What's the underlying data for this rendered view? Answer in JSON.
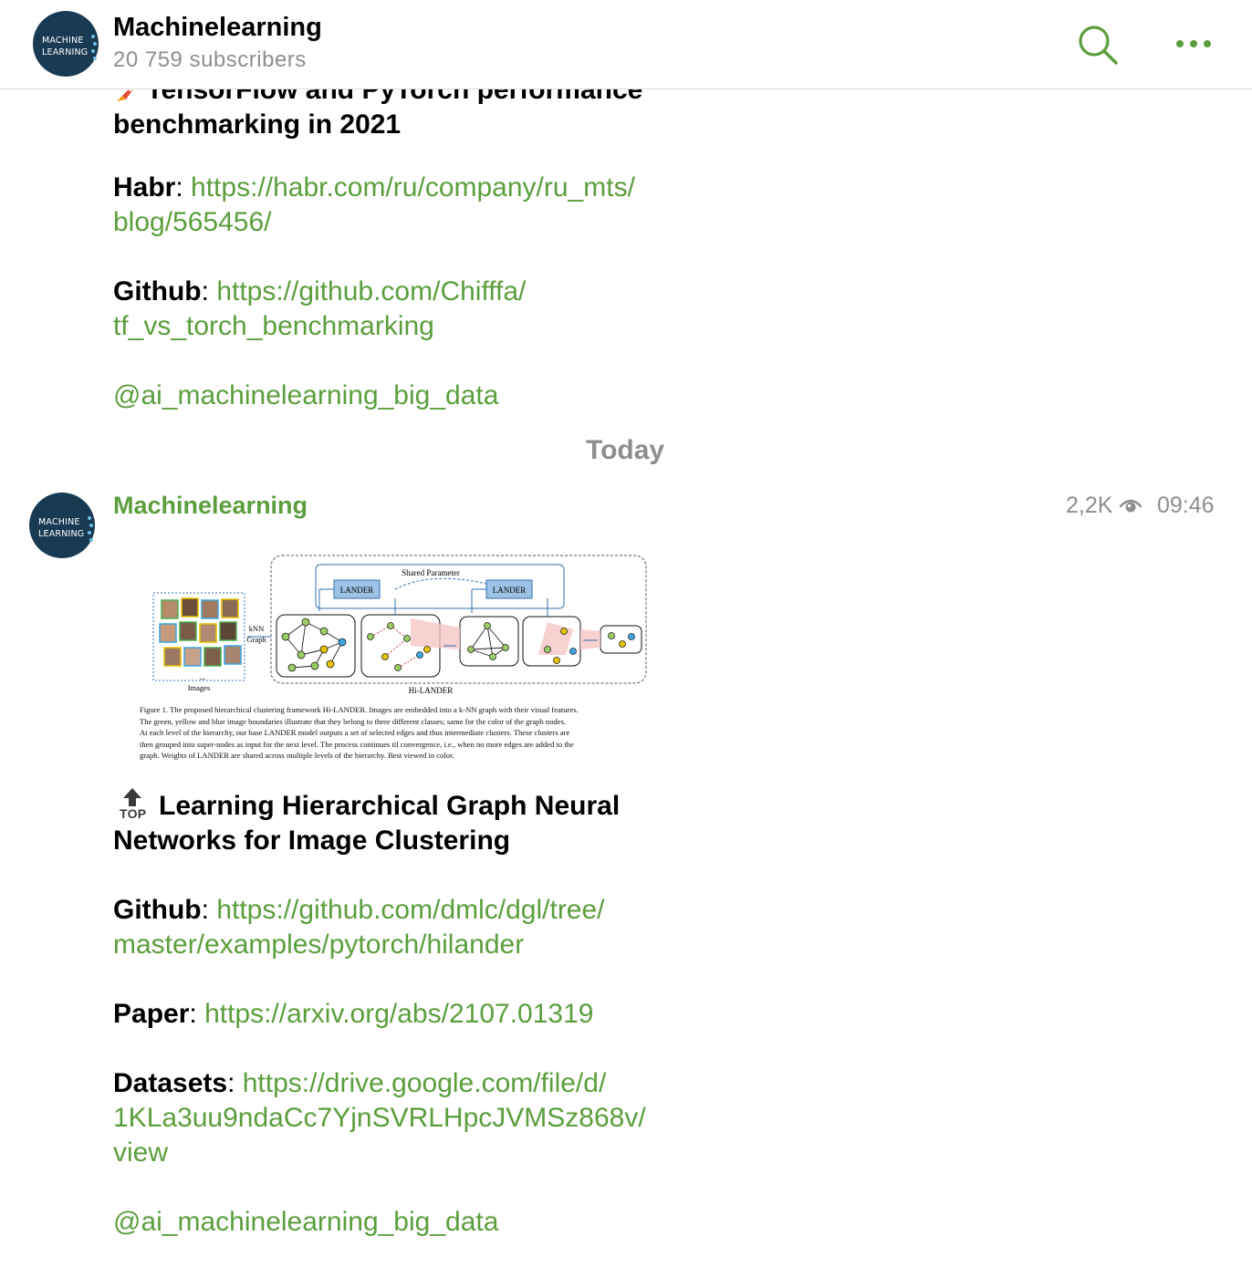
{
  "header": {
    "avatar_line1": "MACHINE",
    "avatar_line2": "LEARNING",
    "title": "Machinelearning",
    "subscribers": "20 759 subscribers"
  },
  "post1": {
    "title_line1": "TensorFlow and PyTorch performance",
    "title_line2": "benchmarking  in 2021",
    "habr_label": "Habr",
    "habr_link_line1": "https://habr.com/ru/company/ru_mts/",
    "habr_link_line2": "blog/565456/",
    "github_label": "Github",
    "github_link_line1": "https://github.com/Chifffa/",
    "github_link_line2": "tf_vs_torch_benchmarking",
    "mention": "@ai_machinelearning_big_data"
  },
  "date_separator": "Today",
  "post2": {
    "sender": "Machinelearning",
    "views": "2,2K",
    "time": "09:46",
    "figure": {
      "shared_parameter": "Shared Parameter",
      "lander_left": "LANDER",
      "lander_right": "LANDER",
      "knn_line1": "kNN",
      "knn_line2": "Graph",
      "images_label": "Images",
      "hilander_label": "Hi-LANDER",
      "caption_lines": [
        "Figure 1. The proposed hierarchical clustering framework Hi-LANDER. Images are embedded into a k-NN graph with their visual features.",
        "The green, yellow and blue image boundaries illustrate that they belong to three different classes; same for the color of the graph nodes.",
        "At each level of the hierarchy, our base LANDER model outputs a set of selected edges and thus intermediate clusters. These clusters are",
        "then grouped into super-nodes as input for the next level. The process continues til convergence, i.e., when no more edges are added to the",
        "graph. Weights of LANDER are shared across multiple levels of the hierarchy. Best viewed in color."
      ]
    },
    "top_badge": "TOP",
    "title_line1": "Learning Hierarchical Graph Neural",
    "title_line2": "Networks for Image Clustering",
    "github_label": "Github",
    "github_link_line1": "https://github.com/dmlc/dgl/tree/",
    "github_link_line2": "master/examples/pytorch/hilander",
    "paper_label": "Paper",
    "paper_link": "https://arxiv.org/abs/2107.01319",
    "datasets_label": "Datasets",
    "datasets_link_line1": "https://drive.google.com/file/d/",
    "datasets_link_line2": "1KLa3uu9ndaCc7YjnSVRLHpcJVMSz868v/",
    "datasets_link_line3": "view",
    "mention": "@ai_machinelearning_big_data"
  },
  "colors": {
    "accent": "#5c9e3d",
    "avatar_bg": "#183a52",
    "muted": "#8e8e8e"
  },
  "icons": [
    "search-icon",
    "more-icon",
    "eye-icon",
    "rocket-icon",
    "top-arrow-icon"
  ]
}
